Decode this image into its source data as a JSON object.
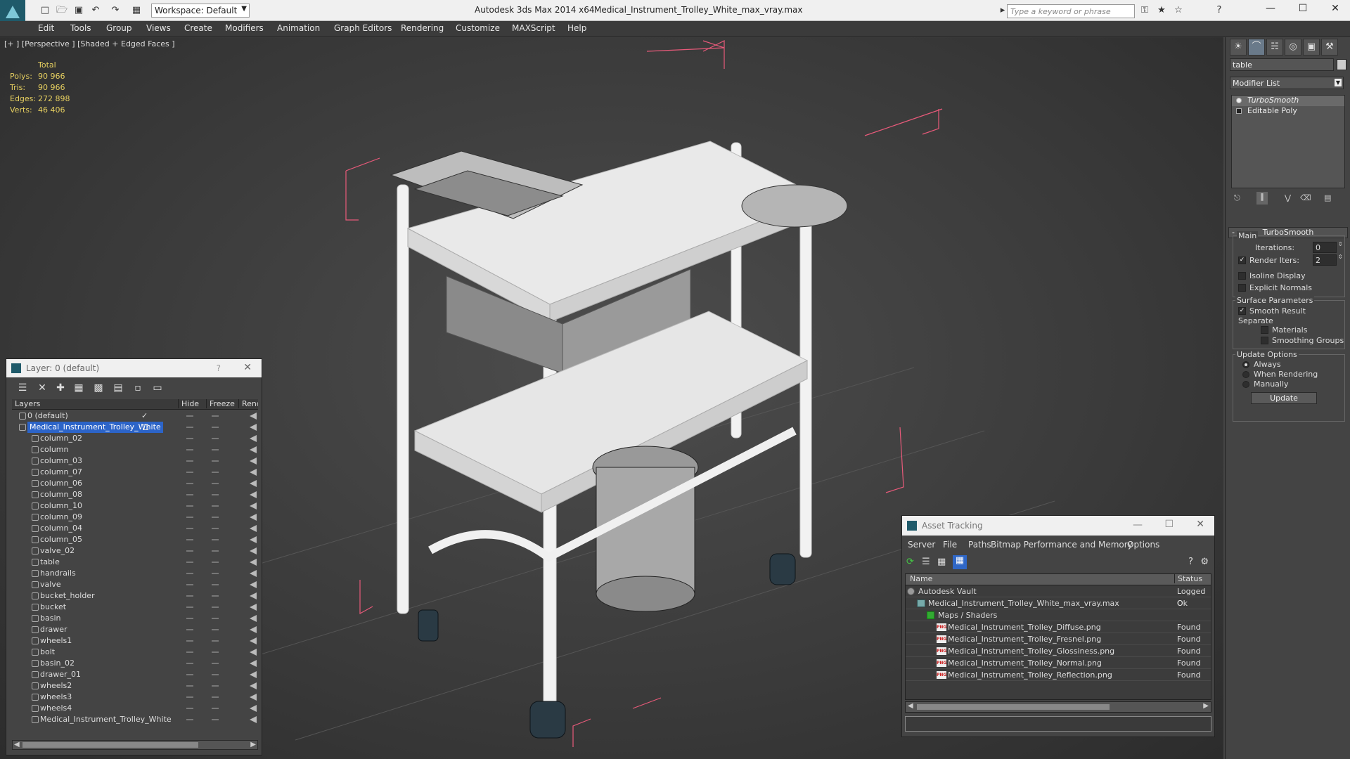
{
  "titlebar": {
    "workspace": "Workspace: Default",
    "app_title": "Autodesk 3ds Max  2014 x64",
    "file_title": "Medical_Instrument_Trolley_White_max_vray.max",
    "search_placeholder": "Type a keyword or phrase"
  },
  "menu": [
    "Edit",
    "Tools",
    "Group",
    "Views",
    "Create",
    "Modifiers",
    "Animation",
    "Graph Editors",
    "Rendering",
    "Customize",
    "MAXScript",
    "Help"
  ],
  "viewport": {
    "label": "[+ ] [Perspective ] [Shaded + Edged Faces ]",
    "stats": {
      "header": "Total",
      "rows": [
        {
          "k": "Polys:",
          "v": "90 966"
        },
        {
          "k": "Tris:",
          "v": "90 966"
        },
        {
          "k": "Edges:",
          "v": "272 898"
        },
        {
          "k": "Verts:",
          "v": "46 406"
        }
      ]
    }
  },
  "command_panel": {
    "object_name": "table",
    "modifier_list": "Modifier List",
    "stack": [
      "TurboSmooth",
      "Editable Poly"
    ],
    "rollout_title": "TurboSmooth",
    "main_label": "Main",
    "iterations_label": "Iterations:",
    "iterations_value": "0",
    "render_iters_label": "Render Iters:",
    "render_iters_value": "2",
    "isoline_label": "Isoline Display",
    "explicit_normals_label": "Explicit Normals",
    "surface_params_label": "Surface Parameters",
    "smooth_result_label": "Smooth Result",
    "separate_label": "Separate",
    "materials_label": "Materials",
    "smoothing_groups_label": "Smoothing Groups",
    "update_options_label": "Update Options",
    "always_label": "Always",
    "when_rendering_label": "When Rendering",
    "manually_label": "Manually",
    "update_button": "Update"
  },
  "layer_window": {
    "title": "Layer: 0 (default)",
    "help": "?",
    "columns": {
      "layers": "Layers",
      "hide": "Hide",
      "freeze": "Freeze",
      "render": "Rend"
    },
    "layers": [
      {
        "name": "0 (default)",
        "level": 0,
        "checked": true
      },
      {
        "name": "Medical_Instrument_Trolley_White",
        "level": 0,
        "selected": true
      },
      {
        "name": "column_02",
        "level": 1
      },
      {
        "name": "column",
        "level": 1
      },
      {
        "name": "column_03",
        "level": 1
      },
      {
        "name": "column_07",
        "level": 1
      },
      {
        "name": "column_06",
        "level": 1
      },
      {
        "name": "column_08",
        "level": 1
      },
      {
        "name": "column_10",
        "level": 1
      },
      {
        "name": "column_09",
        "level": 1
      },
      {
        "name": "column_04",
        "level": 1
      },
      {
        "name": "column_05",
        "level": 1
      },
      {
        "name": "valve_02",
        "level": 1
      },
      {
        "name": "table",
        "level": 1
      },
      {
        "name": "handrails",
        "level": 1
      },
      {
        "name": "valve",
        "level": 1
      },
      {
        "name": "bucket_holder",
        "level": 1
      },
      {
        "name": "bucket",
        "level": 1
      },
      {
        "name": "basin",
        "level": 1
      },
      {
        "name": "drawer",
        "level": 1
      },
      {
        "name": "wheels1",
        "level": 1
      },
      {
        "name": "bolt",
        "level": 1
      },
      {
        "name": "basin_02",
        "level": 1
      },
      {
        "name": "drawer_01",
        "level": 1
      },
      {
        "name": "wheels2",
        "level": 1
      },
      {
        "name": "wheels3",
        "level": 1
      },
      {
        "name": "wheels4",
        "level": 1
      },
      {
        "name": "Medical_Instrument_Trolley_White",
        "level": 1
      }
    ]
  },
  "asset_window": {
    "title": "Asset Tracking",
    "menu": [
      "Server",
      "File",
      "Paths",
      "Bitmap Performance and Memory",
      "Options"
    ],
    "columns": {
      "name": "Name",
      "status": "Status"
    },
    "rows": [
      {
        "name": "Autodesk Vault",
        "status": "Logged O",
        "level": 0,
        "icon": "vault"
      },
      {
        "name": "Medical_Instrument_Trolley_White_max_vray.max",
        "status": "Ok",
        "level": 1,
        "icon": "max"
      },
      {
        "name": "Maps / Shaders",
        "status": "",
        "level": 2,
        "icon": "maps"
      },
      {
        "name": "Medical_Instrument_Trolley_Diffuse.png",
        "status": "Found",
        "level": 3,
        "icon": "png"
      },
      {
        "name": "Medical_Instrument_Trolley_Fresnel.png",
        "status": "Found",
        "level": 3,
        "icon": "png"
      },
      {
        "name": "Medical_Instrument_Trolley_Glossiness.png",
        "status": "Found",
        "level": 3,
        "icon": "png"
      },
      {
        "name": "Medical_Instrument_Trolley_Normal.png",
        "status": "Found",
        "level": 3,
        "icon": "png"
      },
      {
        "name": "Medical_Instrument_Trolley_Reflection.png",
        "status": "Found",
        "level": 3,
        "icon": "png"
      }
    ],
    "png_badge": "PNG"
  }
}
